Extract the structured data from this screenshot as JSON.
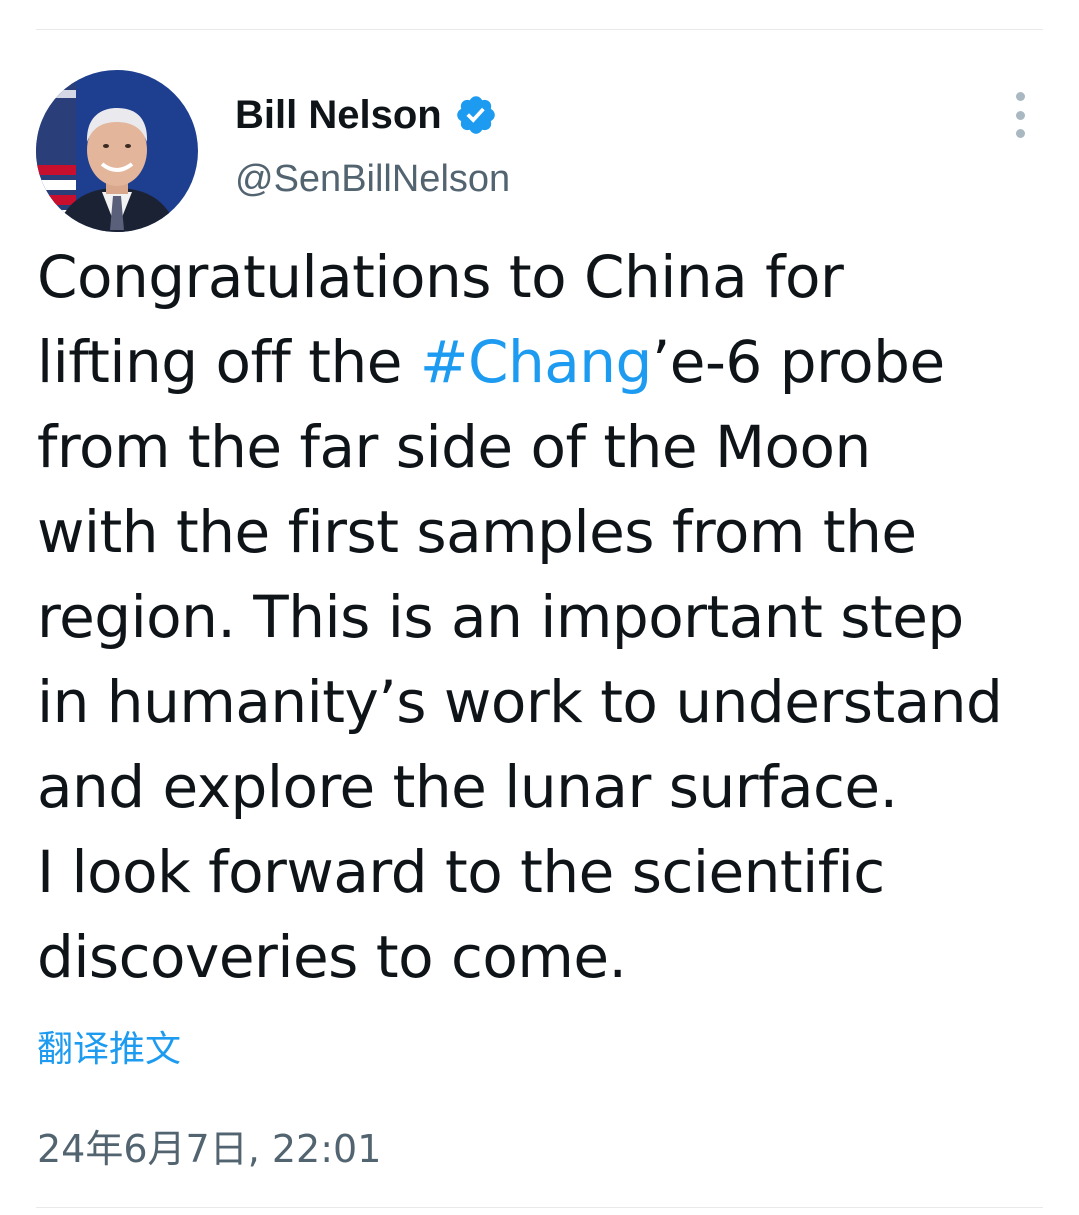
{
  "tweet": {
    "author": {
      "display_name": "Bill Nelson",
      "handle": "@SenBillNelson",
      "verified": true,
      "avatar_icon": "profile-photo",
      "verified_icon": "verified-badge-icon"
    },
    "more_icon": "more-vertical-icon",
    "text": {
      "line1": "Congratulations to China for",
      "line2_prefix": "lifting off the ",
      "line2_hashtag": "#Chang",
      "line2_suffix": "’e-6 probe",
      "line3": "from the far side of the Moon",
      "line4": "with the first samples from the",
      "line5": "region. This is an important step",
      "line6": "in humanity’s work to understand",
      "line7": "and explore the lunar surface.",
      "line8": "I look forward to the scientific",
      "line9": "discoveries to come."
    },
    "translate_label": "翻译推文",
    "timestamp": "24年6月7日, 22:01"
  },
  "colors": {
    "text": "#0f1419",
    "secondary": "#536471",
    "accent": "#1d9bf0",
    "divider": "#e7e9ea"
  }
}
